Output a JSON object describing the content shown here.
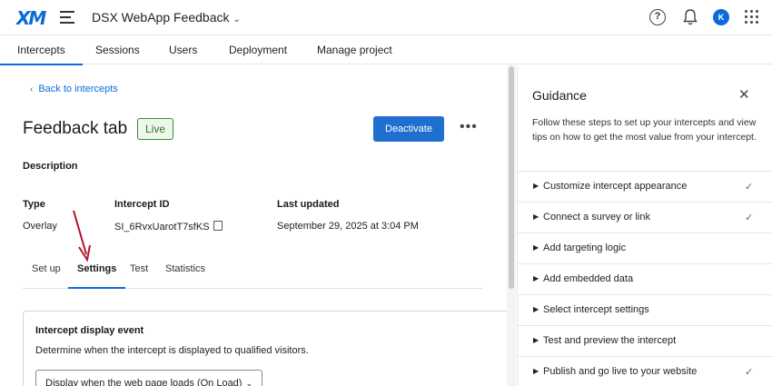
{
  "header": {
    "logo": "XM",
    "project_title": "DSX WebApp Feedback",
    "avatar_initial": "K"
  },
  "nav_tabs": [
    {
      "label": "Intercepts"
    },
    {
      "label": "Sessions"
    },
    {
      "label": "Users"
    },
    {
      "label": "Deployment"
    },
    {
      "label": "Manage project"
    }
  ],
  "main": {
    "back_link": "Back to intercepts",
    "title": "Feedback tab",
    "status_badge": "Live",
    "deactivate_label": "Deactivate",
    "more_label": "•••",
    "description_label": "Description",
    "meta": {
      "type_label": "Type",
      "type_value": "Overlay",
      "id_label": "Intercept ID",
      "id_value": "SI_6RvxUarotT7sfKS",
      "updated_label": "Last updated",
      "updated_value": "September 29, 2025 at 3:04 PM"
    },
    "sub_tabs": [
      {
        "label": "Set up"
      },
      {
        "label": "Settings"
      },
      {
        "label": "Test"
      },
      {
        "label": "Statistics"
      }
    ],
    "active_sub_tab": "Settings",
    "display_event": {
      "title": "Intercept display event",
      "description": "Determine when the intercept is displayed to qualified visitors.",
      "selected": "Display when the web page loads (On Load)"
    }
  },
  "guidance": {
    "title": "Guidance",
    "description": "Follow these steps to set up your intercepts and view tips on how to get the most value from your intercept.",
    "steps": [
      {
        "label": "Customize intercept appearance",
        "done": "✓"
      },
      {
        "label": "Connect a survey or link",
        "done": "✓"
      },
      {
        "label": "Add targeting logic",
        "done": ""
      },
      {
        "label": "Add embedded data",
        "done": ""
      },
      {
        "label": "Select intercept settings",
        "done": ""
      },
      {
        "label": "Test and preview the intercept",
        "done": ""
      },
      {
        "label": "Publish and go live to your website",
        "done": "✓"
      }
    ]
  },
  "colors": {
    "accent": "#0b6bdb",
    "primary_button": "#1f6fd1",
    "live_green": "#2d7a2d",
    "annotation_arrow": "#b0142b"
  }
}
